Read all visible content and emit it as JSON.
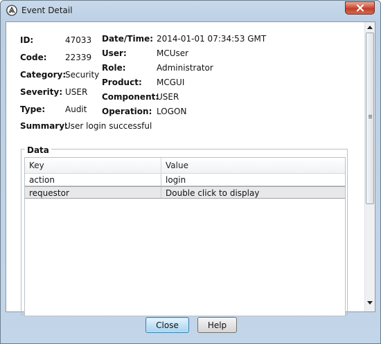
{
  "window": {
    "title": "Event Detail"
  },
  "fields": {
    "id": {
      "label": "ID:",
      "value": "47033"
    },
    "code": {
      "label": "Code:",
      "value": "22339"
    },
    "category": {
      "label": "Category:",
      "value": "Security"
    },
    "severity": {
      "label": "Severity:",
      "value": "USER"
    },
    "type": {
      "label": "Type:",
      "value": "Audit"
    },
    "summary": {
      "label": "Summary:",
      "value": "User login successful"
    },
    "datetime": {
      "label": "Date/Time:",
      "value": "2014-01-01 07:34:53 GMT"
    },
    "user": {
      "label": "User:",
      "value": "MCUser"
    },
    "role": {
      "label": "Role:",
      "value": "Administrator"
    },
    "product": {
      "label": "Product:",
      "value": "MCGUI"
    },
    "component": {
      "label": "Component:",
      "value": "USER"
    },
    "operation": {
      "label": "Operation:",
      "value": "LOGON"
    }
  },
  "data_group": {
    "title": "Data",
    "columns": [
      "Key",
      "Value"
    ],
    "rows": [
      {
        "key": "action",
        "value": "login"
      },
      {
        "key": "requestor",
        "value": "Double click to display"
      }
    ]
  },
  "buttons": {
    "close": "Close",
    "help": "Help"
  },
  "icons": {
    "app": "app-logo-icon",
    "close": "close-icon"
  }
}
